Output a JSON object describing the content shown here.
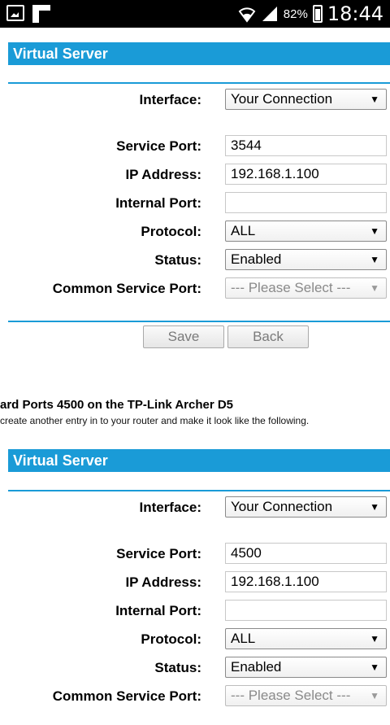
{
  "status_bar": {
    "battery_percent": "82%",
    "time": "18:44"
  },
  "panel1": {
    "header": "Virtual Server",
    "interface_label": "Interface:",
    "interface_value": "Your Connection",
    "service_port_label": "Service Port:",
    "service_port_value": "3544",
    "ip_address_label": "IP Address:",
    "ip_address_value": "192.168.1.100",
    "internal_port_label": "Internal Port:",
    "internal_port_value": "",
    "protocol_label": "Protocol:",
    "protocol_value": "ALL",
    "status_label": "Status:",
    "status_value": "Enabled",
    "common_service_port_label": "Common Service Port:",
    "common_service_port_value": "--- Please Select ---",
    "save_label": "Save",
    "back_label": "Back"
  },
  "article": {
    "title": "ard Ports 4500 on the TP-Link Archer D5",
    "text": "create another entry in to your router and make it look like the following."
  },
  "panel2": {
    "header": "Virtual Server",
    "interface_label": "Interface:",
    "interface_value": "Your Connection",
    "service_port_label": "Service Port:",
    "service_port_value": "4500",
    "ip_address_label": "IP Address:",
    "ip_address_value": "192.168.1.100",
    "internal_port_label": "Internal Port:",
    "internal_port_value": "",
    "protocol_label": "Protocol:",
    "protocol_value": "ALL",
    "status_label": "Status:",
    "status_value": "Enabled",
    "common_service_port_label": "Common Service Port:",
    "common_service_port_value": "--- Please Select ---"
  }
}
